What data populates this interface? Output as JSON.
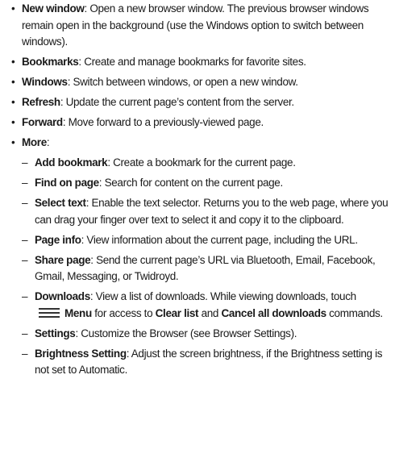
{
  "items": [
    {
      "term": "New window",
      "desc": ": Open a new browser window. The previous browser windows remain open in the background (use the Windows option to switch between windows)."
    },
    {
      "term": "Bookmarks",
      "desc": ": Create and manage bookmarks for favorite sites."
    },
    {
      "term": "Windows",
      "desc": ": Switch between windows, or open a new window."
    },
    {
      "term": "Refresh",
      "desc": ": Update the current page’s content from the server."
    },
    {
      "term": "Forward",
      "desc": ": Move forward to a previously-viewed page."
    },
    {
      "term": "More",
      "desc": ":"
    }
  ],
  "sub_items": [
    {
      "term": "Add bookmark",
      "desc": ": Create a bookmark for the current page."
    },
    {
      "term": "Find on page",
      "desc": ": Search for content on the current page."
    },
    {
      "term": "Select text",
      "desc": ": Enable the text selector. Returns you to the web page, where you can drag your finger over text to select it and copy it to the clipboard."
    },
    {
      "term": "Page info",
      "desc": ": View information about the current page, including the URL."
    },
    {
      "term": "Share page",
      "desc": ": Send the current page’s URL via Bluetooth, Email, Facebook, Gmail, Messaging, or Twidroyd."
    },
    {
      "term": "Downloads",
      "desc": ": View a list of downloads. While viewing downloads, touch",
      "menu_label": "Menu",
      "mid": " for access to ",
      "clear": "Clear list",
      "and": " and ",
      "cancel": "Cancel all downloads",
      "tail": " commands."
    },
    {
      "term": "Settings",
      "desc": ": Customize the Browser (see Browser Settings)."
    },
    {
      "term": "Brightness Setting",
      "desc": ": Adjust the screen brightness, if the Brightness setting is not set to Automatic."
    }
  ],
  "symbols": {
    "bullet": "•",
    "dash": "–"
  },
  "icons": {
    "menu": "menu-icon"
  }
}
